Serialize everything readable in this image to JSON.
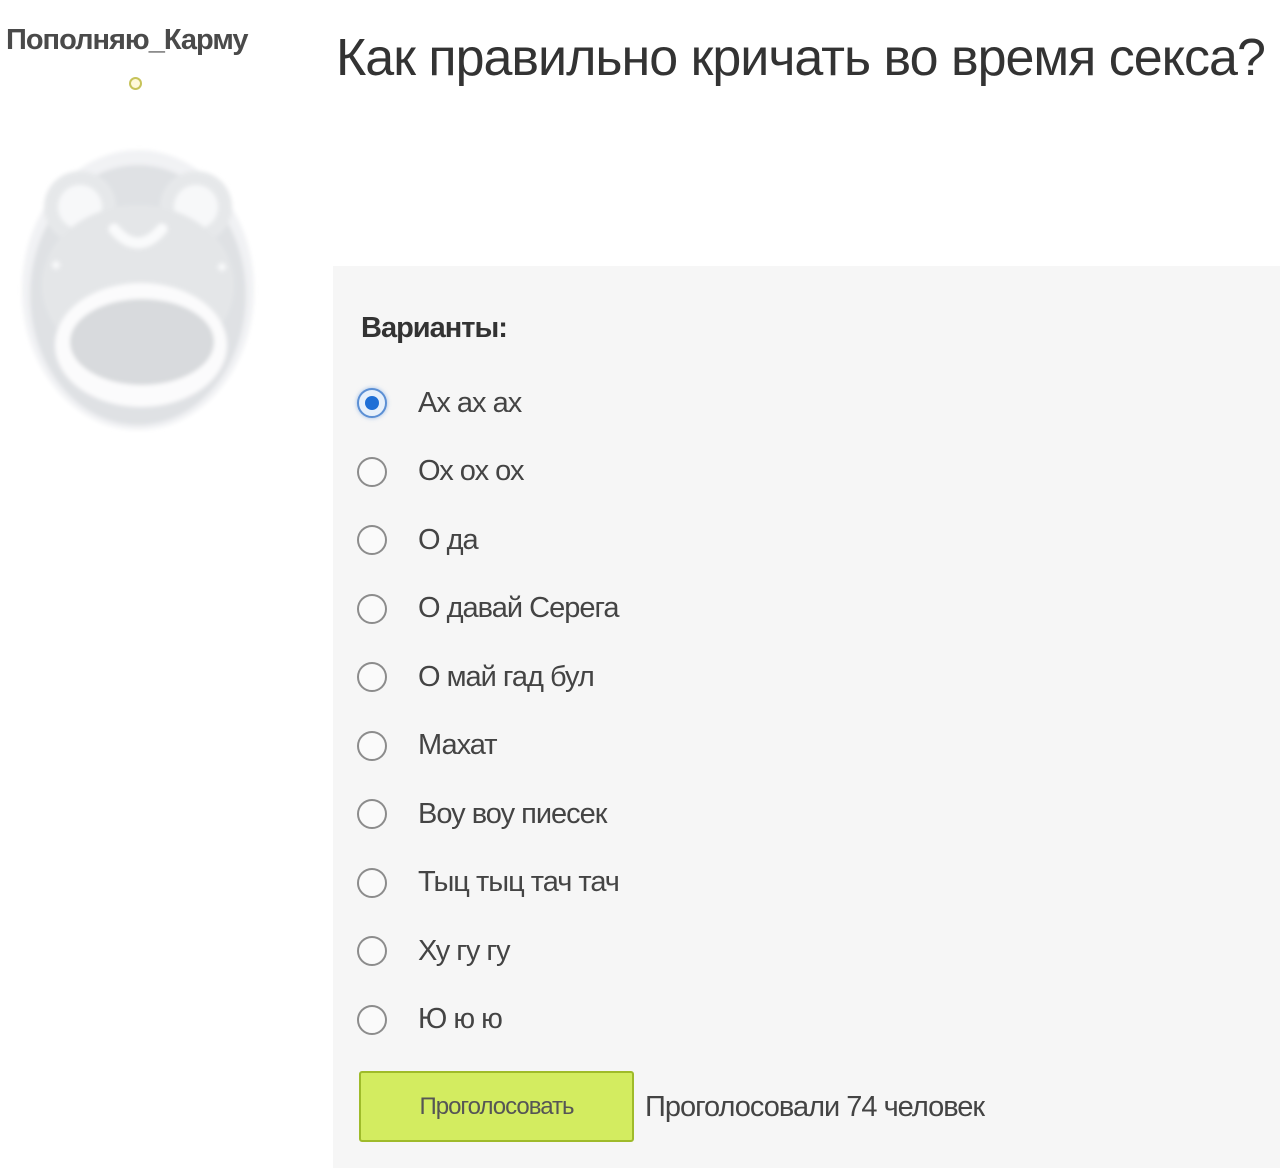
{
  "user": {
    "username": "Пополняю_Карму",
    "avatar_icon": "frog-avatar-icon",
    "status_icon": "online-status-icon"
  },
  "question": {
    "title": "Как правильно кричать во время секса?"
  },
  "poll": {
    "options_heading": "Варианты:",
    "options": [
      {
        "label": "Ах ах ах",
        "selected": true
      },
      {
        "label": "Ох ох ох",
        "selected": false
      },
      {
        "label": "О да",
        "selected": false
      },
      {
        "label": "О давай Серега",
        "selected": false
      },
      {
        "label": "О май гад бул",
        "selected": false
      },
      {
        "label": "Махат",
        "selected": false
      },
      {
        "label": "Воу воу пиесек",
        "selected": false
      },
      {
        "label": "Тыц тыц тач тач",
        "selected": false
      },
      {
        "label": "Ху гу гу",
        "selected": false
      },
      {
        "label": "Ю ю ю",
        "selected": false
      }
    ],
    "vote_button_label": "Проголосовать",
    "vote_count_text": "Проголосовали 74 человек"
  },
  "colors": {
    "panel_background": "#f6f6f6",
    "vote_button": "#d3ec60",
    "radio_selected": "#1e6fd6"
  }
}
